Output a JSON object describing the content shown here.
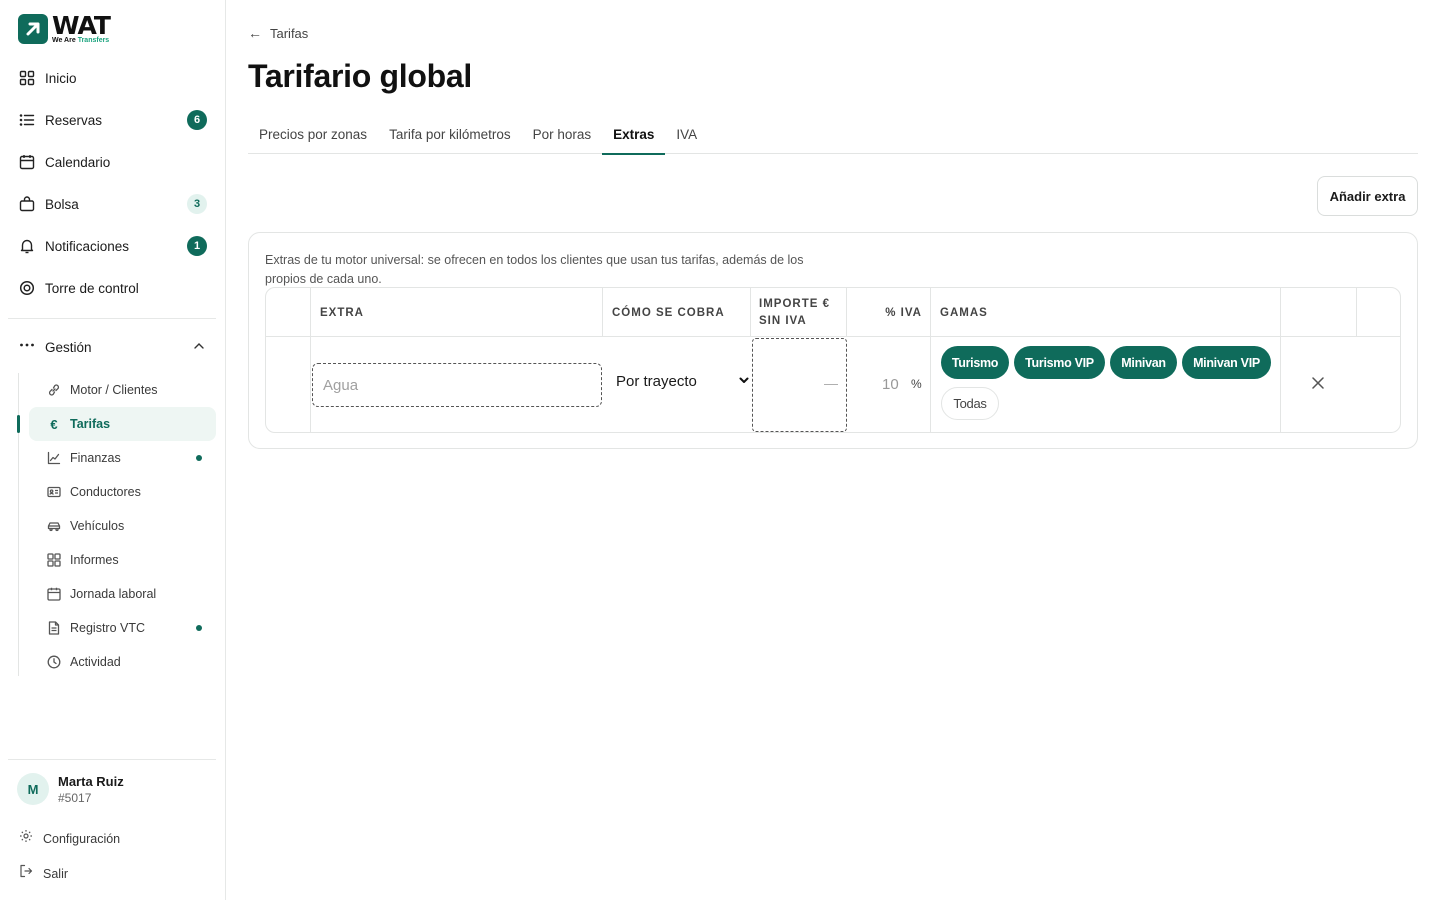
{
  "brand": {
    "name": "WAT",
    "sub_prefix": "We Are ",
    "sub_highlight": "Transfers",
    "color": "#0f6b5b"
  },
  "nav": {
    "main": [
      {
        "label": "Inicio",
        "icon": "grid-icon"
      },
      {
        "label": "Reservas",
        "icon": "list-icon",
        "badge": "6"
      },
      {
        "label": "Calendario",
        "icon": "calendar-icon"
      },
      {
        "label": "Bolsa",
        "icon": "bag-icon",
        "badge": "3"
      },
      {
        "label": "Notificaciones",
        "icon": "bell-icon",
        "badge": "1"
      },
      {
        "label": "Torre de control",
        "icon": "target-icon"
      }
    ],
    "group": {
      "label": "Gestión",
      "icon": "more-icon"
    },
    "sub": [
      {
        "label": "Motor / Clientes",
        "icon": "link-icon"
      },
      {
        "label": "Tarifas",
        "icon": "euro-icon",
        "active": true
      },
      {
        "label": "Finanzas",
        "icon": "chart-icon",
        "dot": true
      },
      {
        "label": "Conductores",
        "icon": "id-card-icon"
      },
      {
        "label": "Vehículos",
        "icon": "car-icon"
      },
      {
        "label": "Informes",
        "icon": "grid-icon"
      },
      {
        "label": "Jornada laboral",
        "icon": "calendar-icon"
      },
      {
        "label": "Registro VTC",
        "icon": "document-icon",
        "dot": true
      },
      {
        "label": "Actividad",
        "icon": "clock-icon"
      }
    ]
  },
  "user": {
    "initial": "M",
    "name": "Marta Ruiz",
    "id": "#5017"
  },
  "footer": {
    "settings": "Configuración",
    "logout": "Salir"
  },
  "page": {
    "back_label": "Tarifas",
    "title": "Tarifario global",
    "tabs": [
      "Precios por zonas",
      "Tarifa por kilómetros",
      "Por horas",
      "Extras",
      "IVA"
    ],
    "active_tab": "Extras",
    "add_button": "Añadir extra"
  },
  "extras_card": {
    "description": "Extras de tu motor universal: se ofrecen en todos los clientes que usan tus tarifas, además de los propios de cada uno.",
    "columns": {
      "extra": "EXTRA",
      "cobro": "CÓMO SE COBRA",
      "importe_1": "IMPORTE €",
      "importe_2": "SIN IVA",
      "iva": "% IVA",
      "gamas": "GAMAS"
    },
    "row": {
      "extra_placeholder": "Agua",
      "cobro": "Por trayecto",
      "importe": "—",
      "iva": "10",
      "iva_unit": "%",
      "gamas": [
        "Turismo",
        "Turismo VIP",
        "Minivan",
        "Minivan VIP"
      ],
      "gamas_all": "Todas"
    }
  }
}
